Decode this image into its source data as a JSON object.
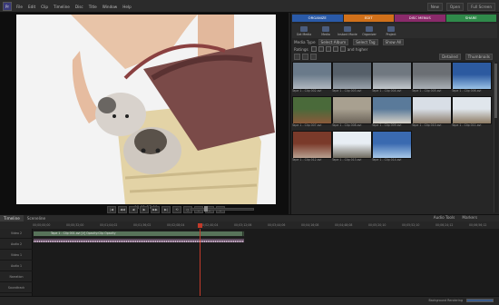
{
  "menu": [
    "File",
    "Edit",
    "Clip",
    "Timeline",
    "Disc",
    "Title",
    "Window",
    "Help"
  ],
  "app_logo": "Pr",
  "top_right": {
    "new": "New",
    "open": "Open",
    "full_screen": "Full Screen"
  },
  "monitor": {
    "timecode": "00;01;57;00"
  },
  "transport": [
    "|◀",
    "◀◀",
    "◀",
    "▶",
    "▶▶",
    "▶|",
    "⟲",
    "◻",
    "◻",
    "◻",
    "◻"
  ],
  "mode_tabs": [
    {
      "label": "ORGANIZE",
      "color": "#2a5aa8"
    },
    {
      "label": "EDIT",
      "color": "#d0701a"
    },
    {
      "label": "DISC MENUS",
      "color": "#8a2a6a"
    },
    {
      "label": "SHARE",
      "color": "#2f8a4a"
    }
  ],
  "sub_buttons": [
    "Get Media",
    "Media",
    "Instant Movie",
    "Organizer",
    "Project"
  ],
  "filters": {
    "row1": [
      {
        "label": "Media Type",
        "value": "Select Album"
      },
      {
        "label": "",
        "value": "Select Tag"
      },
      {
        "label": "",
        "value": "Show All"
      }
    ],
    "row2_label": "Ratings",
    "row2_value": "and higher"
  },
  "view": {
    "detail_label": "Detailed",
    "thumb_label": "Thumbnails"
  },
  "thumbs": [
    {
      "caption": "Tape 1 - Clip 002.avi",
      "colors": [
        "#6a7a8a",
        "#b0b8c0"
      ]
    },
    {
      "caption": "Tape 1 - Clip 003.avi",
      "colors": [
        "#56606a",
        "#9aa3ac"
      ]
    },
    {
      "caption": "Tape 1 - Clip 004.avi",
      "colors": [
        "#707880",
        "#c2c7cc"
      ]
    },
    {
      "caption": "Tape 1 - Clip 005.avi",
      "colors": [
        "#6b6f74",
        "#aab0b6"
      ]
    },
    {
      "caption": "Tape 1 - Clip 006.avi",
      "colors": [
        "#2c5aa0",
        "#9ac2e6"
      ]
    },
    {
      "caption": "Tape 1 - Clip 007.avi",
      "colors": [
        "#4a6a3a",
        "#8a5a3a"
      ]
    },
    {
      "caption": "Tape 1 - Clip 008.avi",
      "colors": [
        "#a8a090",
        "#6a6258"
      ]
    },
    {
      "caption": "Tape 1 - Clip 009.avi",
      "colors": [
        "#5a7a9a",
        "#d8d2c8"
      ]
    },
    {
      "caption": "Tape 1 - Clip 010.avi",
      "colors": [
        "#d8dee6",
        "#8a7a68"
      ]
    },
    {
      "caption": "Tape 1 - Clip 011.avi",
      "colors": [
        "#e0e6ec",
        "#8c7a62"
      ]
    },
    {
      "caption": "Tape 1 - Clip 012.avi",
      "colors": [
        "#7a3a2a",
        "#b8a090"
      ]
    },
    {
      "caption": "Tape 1 - Clip 013.avi",
      "colors": [
        "#e8eef4",
        "#6e6a5e"
      ]
    },
    {
      "caption": "Tape 1 - Clip 014.avi",
      "colors": [
        "#3a6ab0",
        "#a8c8e8"
      ]
    }
  ],
  "timeline": {
    "tabs": [
      "Timeline",
      "Sceneline"
    ],
    "right_labels": [
      "Audio Tools",
      "Markers"
    ],
    "ruler": [
      "00;00;00;00",
      "00;00;32;00",
      "00;01;04;02",
      "00;01;36;02",
      "00;02;08;04",
      "00;02;40;04",
      "00;03;12;06",
      "00;03;44;06",
      "00;04;16;08",
      "00;04;48;08",
      "00;05;20;10",
      "00;05;52;10",
      "00;06;24;12",
      "00;06;56;12"
    ],
    "track_labels": [
      "Video 2",
      "Audio 2",
      "Video 1",
      "Audio 1",
      "Narration",
      "Soundtrack"
    ],
    "clip_label": "Tape 1 - Clip 001.avi [V] Opacity:Clip Opacity"
  },
  "status": {
    "text": "Background Rendering"
  }
}
